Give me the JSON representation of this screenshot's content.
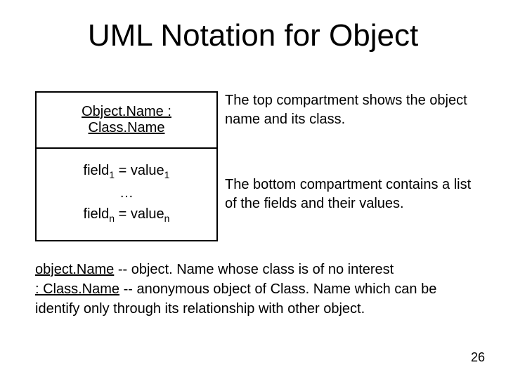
{
  "title": "UML Notation for Object",
  "uml": {
    "header": "Object.Name : Class.Name",
    "row1_field": "field",
    "row1_sub": "1",
    "row1_eq": " = value",
    "row1_sub2": "1",
    "ellipsis": "…",
    "rown_field": "field",
    "rown_sub": "n",
    "rown_eq": " = value",
    "rown_sub2": "n"
  },
  "desc_top": "The top compartment shows the object name and its class.",
  "desc_bottom": "The bottom compartment contains a list of the fields and their values.",
  "note1_term": "object.Name",
  "note1_rest": " -- object. Name whose class is of no interest",
  "note2_term": ": Class.Name",
  "note2_rest": " -- anonymous object of Class. Name which can be identify only through its relationship with other object.",
  "page_number": "26"
}
